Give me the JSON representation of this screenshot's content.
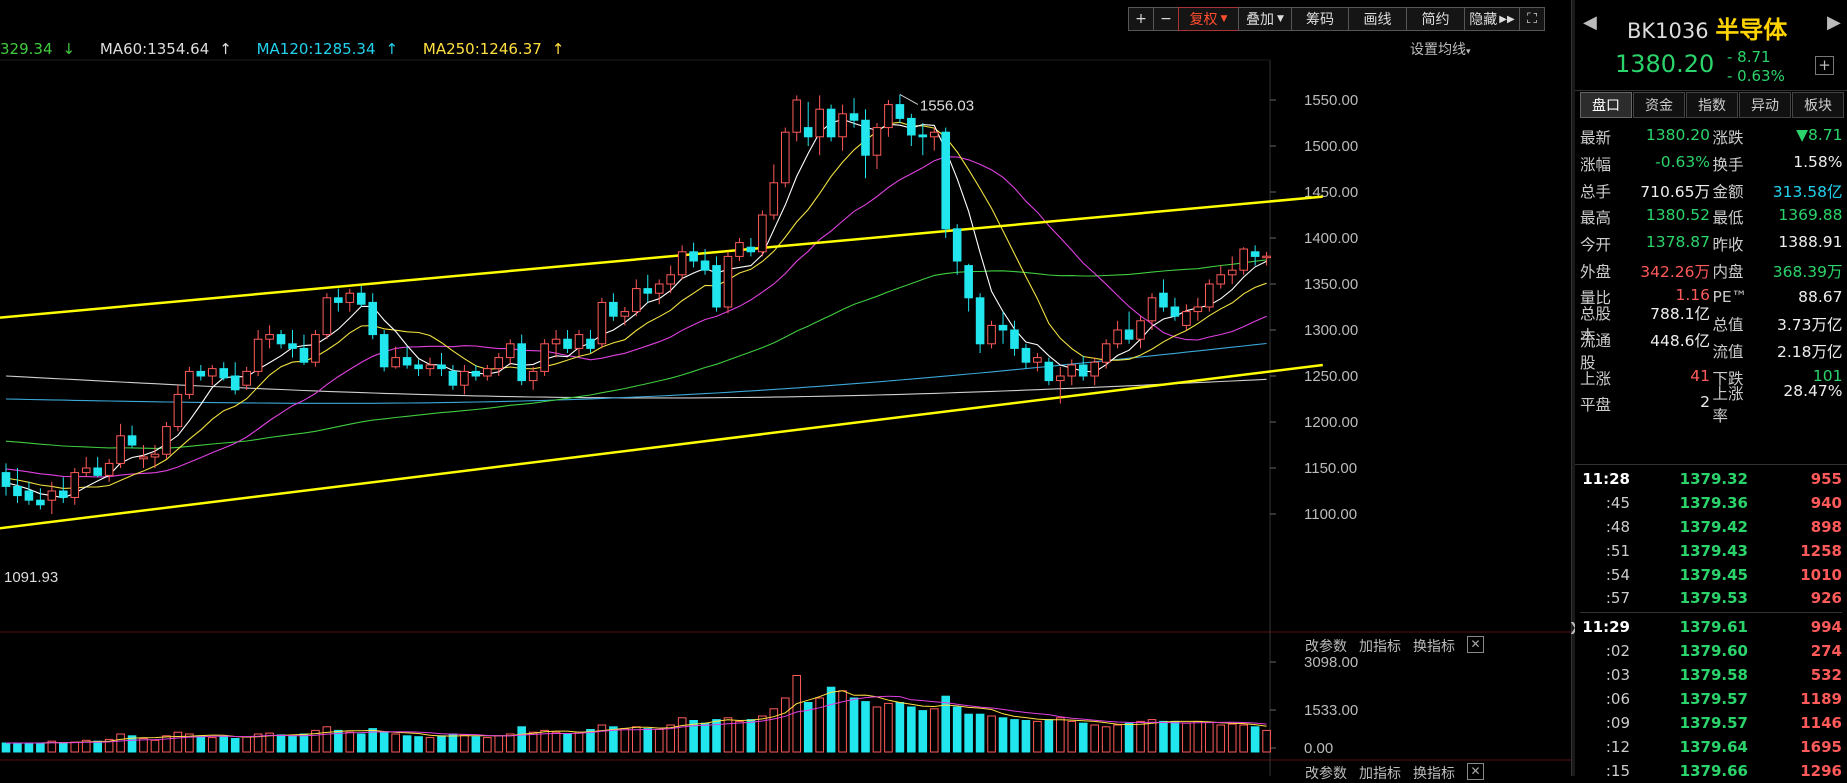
{
  "toolbar": {
    "zoom_in": "+",
    "zoom_out": "−",
    "fuquan": "复权",
    "diejia": "叠加",
    "chouma": "筹码",
    "huaxian": "画线",
    "jianjie": "简约",
    "yincang": "隐藏",
    "fullscreen": "⛶"
  },
  "ma_labels": {
    "ma_partial": "329.34",
    "ma60": "MA60:1354.64",
    "ma120": "MA120:1285.34",
    "ma250": "MA250:1246.37",
    "settings": "设置均线"
  },
  "colors": {
    "up": "#ff5a5a",
    "down": "#22e6ee",
    "ma5": "#ffffff",
    "ma10": "#f0e040",
    "ma20": "#e040e0",
    "ma60": "#3fcc3f",
    "ma120": "#3aa8d8",
    "ma250": "#cfcfcf",
    "trendline": "#ffff00",
    "panel_green": "#2bd46b",
    "panel_red": "#ff5a5a"
  },
  "chart_data": {
    "type": "candlestick",
    "price_axis": {
      "ticks": [
        "1550.00",
        "1500.00",
        "1450.00",
        "1400.00",
        "1350.00",
        "1300.00",
        "1250.00",
        "1200.00",
        "1150.00",
        "1100.00"
      ]
    },
    "volume_axis": {
      "ticks": [
        "3098.00",
        "1533.00",
        "0.00"
      ]
    },
    "annotations": {
      "high": "1556.03",
      "low": "1091.93"
    },
    "ma_values": {
      "ma60": 1354.64,
      "ma120": 1285.34,
      "ma250": 1246.37
    },
    "trendlines": [
      {
        "from": [
          0,
          1313
        ],
        "to": [
          80,
          1445
        ]
      },
      {
        "from": [
          0,
          1084
        ],
        "to": [
          80,
          1262
        ]
      }
    ],
    "ohlc": [
      [
        1145,
        1155,
        1120,
        1130
      ],
      [
        1130,
        1150,
        1112,
        1120
      ],
      [
        1125,
        1135,
        1110,
        1115
      ],
      [
        1115,
        1128,
        1105,
        1110
      ],
      [
        1115,
        1135,
        1100,
        1125
      ],
      [
        1125,
        1140,
        1112,
        1118
      ],
      [
        1118,
        1150,
        1110,
        1145
      ],
      [
        1145,
        1162,
        1140,
        1150
      ],
      [
        1150,
        1162,
        1140,
        1142
      ],
      [
        1142,
        1160,
        1135,
        1155
      ],
      [
        1155,
        1198,
        1150,
        1185
      ],
      [
        1185,
        1196,
        1172,
        1175
      ],
      [
        1160,
        1175,
        1150,
        1162
      ],
      [
        1162,
        1175,
        1150,
        1165
      ],
      [
        1165,
        1200,
        1160,
        1195
      ],
      [
        1195,
        1240,
        1190,
        1230
      ],
      [
        1230,
        1260,
        1225,
        1255
      ],
      [
        1255,
        1262,
        1245,
        1250
      ],
      [
        1250,
        1262,
        1240,
        1258
      ],
      [
        1258,
        1265,
        1245,
        1248
      ],
      [
        1250,
        1265,
        1230,
        1235
      ],
      [
        1240,
        1260,
        1235,
        1255
      ],
      [
        1255,
        1300,
        1250,
        1290
      ],
      [
        1290,
        1305,
        1280,
        1295
      ],
      [
        1295,
        1300,
        1280,
        1285
      ],
      [
        1285,
        1300,
        1270,
        1280
      ],
      [
        1280,
        1295,
        1262,
        1265
      ],
      [
        1265,
        1300,
        1260,
        1295
      ],
      [
        1295,
        1340,
        1290,
        1335
      ],
      [
        1335,
        1345,
        1320,
        1330
      ],
      [
        1330,
        1345,
        1320,
        1340
      ],
      [
        1340,
        1348,
        1325,
        1328
      ],
      [
        1330,
        1340,
        1290,
        1295
      ],
      [
        1295,
        1300,
        1255,
        1260
      ],
      [
        1260,
        1282,
        1258,
        1270
      ],
      [
        1270,
        1282,
        1258,
        1262
      ],
      [
        1262,
        1268,
        1250,
        1258
      ],
      [
        1258,
        1270,
        1250,
        1262
      ],
      [
        1262,
        1275,
        1250,
        1258
      ],
      [
        1255,
        1262,
        1235,
        1240
      ],
      [
        1240,
        1262,
        1230,
        1255
      ],
      [
        1255,
        1262,
        1245,
        1250
      ],
      [
        1250,
        1262,
        1245,
        1258
      ],
      [
        1258,
        1275,
        1250,
        1270
      ],
      [
        1270,
        1290,
        1262,
        1285
      ],
      [
        1285,
        1295,
        1240,
        1245
      ],
      [
        1245,
        1260,
        1235,
        1255
      ],
      [
        1255,
        1290,
        1250,
        1285
      ],
      [
        1285,
        1300,
        1270,
        1290
      ],
      [
        1290,
        1300,
        1275,
        1280
      ],
      [
        1280,
        1300,
        1272,
        1295
      ],
      [
        1290,
        1300,
        1275,
        1280
      ],
      [
        1285,
        1335,
        1280,
        1330
      ],
      [
        1330,
        1340,
        1310,
        1315
      ],
      [
        1315,
        1325,
        1305,
        1320
      ],
      [
        1320,
        1355,
        1315,
        1345
      ],
      [
        1345,
        1360,
        1330,
        1340
      ],
      [
        1340,
        1355,
        1328,
        1350
      ],
      [
        1350,
        1370,
        1340,
        1360
      ],
      [
        1360,
        1392,
        1355,
        1385
      ],
      [
        1385,
        1395,
        1368,
        1375
      ],
      [
        1375,
        1388,
        1360,
        1365
      ],
      [
        1370,
        1380,
        1320,
        1325
      ],
      [
        1325,
        1385,
        1318,
        1380
      ],
      [
        1380,
        1400,
        1375,
        1395
      ],
      [
        1390,
        1400,
        1380,
        1385
      ],
      [
        1385,
        1430,
        1380,
        1425
      ],
      [
        1425,
        1480,
        1420,
        1460
      ],
      [
        1460,
        1520,
        1455,
        1515
      ],
      [
        1515,
        1555,
        1505,
        1550
      ],
      [
        1520,
        1548,
        1500,
        1510
      ],
      [
        1510,
        1555,
        1490,
        1540
      ],
      [
        1540,
        1545,
        1505,
        1510
      ],
      [
        1510,
        1545,
        1495,
        1535
      ],
      [
        1535,
        1552,
        1520,
        1528
      ],
      [
        1528,
        1540,
        1465,
        1490
      ],
      [
        1490,
        1525,
        1475,
        1520
      ],
      [
        1520,
        1550,
        1510,
        1545
      ],
      [
        1545,
        1556.03,
        1525,
        1530
      ],
      [
        1530,
        1535,
        1500,
        1512
      ],
      [
        1512,
        1525,
        1490,
        1510
      ],
      [
        1510,
        1520,
        1495,
        1515
      ],
      [
        1515,
        1520,
        1400,
        1410
      ],
      [
        1410,
        1415,
        1360,
        1375
      ],
      [
        1370,
        1372,
        1320,
        1335
      ],
      [
        1335,
        1340,
        1275,
        1285
      ],
      [
        1285,
        1310,
        1280,
        1305
      ],
      [
        1305,
        1320,
        1285,
        1300
      ],
      [
        1300,
        1310,
        1272,
        1280
      ],
      [
        1280,
        1285,
        1258,
        1265
      ],
      [
        1265,
        1275,
        1255,
        1270
      ],
      [
        1265,
        1270,
        1240,
        1245
      ],
      [
        1245,
        1260,
        1220,
        1250
      ],
      [
        1250,
        1268,
        1240,
        1262
      ],
      [
        1262,
        1272,
        1245,
        1250
      ],
      [
        1250,
        1270,
        1240,
        1265
      ],
      [
        1265,
        1290,
        1258,
        1285
      ],
      [
        1285,
        1310,
        1280,
        1300
      ],
      [
        1300,
        1320,
        1285,
        1290
      ],
      [
        1290,
        1315,
        1280,
        1310
      ],
      [
        1310,
        1340,
        1300,
        1335
      ],
      [
        1340,
        1355,
        1320,
        1325
      ],
      [
        1325,
        1335,
        1310,
        1315
      ],
      [
        1305,
        1328,
        1300,
        1320
      ],
      [
        1320,
        1335,
        1310,
        1325
      ],
      [
        1325,
        1355,
        1320,
        1350
      ],
      [
        1350,
        1370,
        1345,
        1360
      ],
      [
        1360,
        1380,
        1350,
        1365
      ],
      [
        1365,
        1390,
        1360,
        1388
      ],
      [
        1385,
        1392,
        1370,
        1380
      ],
      [
        1380.2,
        1385,
        1370,
        1380.2
      ]
    ],
    "volume_ratio": [
      0.1,
      0.1,
      0.1,
      0.1,
      0.12,
      0.1,
      0.11,
      0.13,
      0.12,
      0.14,
      0.2,
      0.18,
      0.15,
      0.13,
      0.18,
      0.22,
      0.2,
      0.18,
      0.16,
      0.17,
      0.15,
      0.17,
      0.2,
      0.21,
      0.19,
      0.18,
      0.2,
      0.24,
      0.28,
      0.24,
      0.22,
      0.2,
      0.26,
      0.22,
      0.2,
      0.18,
      0.17,
      0.16,
      0.18,
      0.2,
      0.19,
      0.17,
      0.16,
      0.18,
      0.2,
      0.28,
      0.22,
      0.24,
      0.22,
      0.2,
      0.22,
      0.25,
      0.3,
      0.28,
      0.26,
      0.28,
      0.26,
      0.25,
      0.3,
      0.38,
      0.35,
      0.32,
      0.36,
      0.38,
      0.34,
      0.36,
      0.4,
      0.48,
      0.6,
      0.85,
      0.55,
      0.6,
      0.72,
      0.68,
      0.6,
      0.56,
      0.5,
      0.54,
      0.55,
      0.5,
      0.46,
      0.48,
      0.62,
      0.5,
      0.42,
      0.42,
      0.4,
      0.38,
      0.36,
      0.35,
      0.34,
      0.36,
      0.38,
      0.34,
      0.32,
      0.3,
      0.28,
      0.3,
      0.32,
      0.34,
      0.36,
      0.34,
      0.34,
      0.32,
      0.34,
      0.33,
      0.3,
      0.31,
      0.3,
      0.28,
      0.24
    ]
  },
  "sub_tools": {
    "params": "改参数",
    "add_indicator": "加指标",
    "switch_indicator": "换指标",
    "close": "✕"
  },
  "panel": {
    "code": "BK1036",
    "name": "半导体",
    "price": "1380.20",
    "change": "- 8.71",
    "change_pct": "- 0.63%",
    "plus": "+",
    "prev_arrow": "◀",
    "next_arrow": "▶",
    "tabs": [
      "盘口",
      "资金",
      "指数",
      "异动",
      "板块"
    ],
    "quote": [
      {
        "l1": "最新",
        "v1": "1380.20",
        "c1": "down",
        "l2": "涨跌",
        "v2": "▼8.71",
        "c2": "down"
      },
      {
        "l1": "涨幅",
        "v1": "-0.63%",
        "c1": "down",
        "l2": "换手",
        "v2": "1.58%",
        "c2": "white"
      },
      {
        "l1": "总手",
        "v1": "710.65万",
        "c1": "white",
        "l2": "金额",
        "v2": "313.58亿",
        "c2": "cyan"
      },
      {
        "l1": "最高",
        "v1": "1380.52",
        "c1": "down",
        "l2": "最低",
        "v2": "1369.88",
        "c2": "down"
      },
      {
        "l1": "今开",
        "v1": "1378.87",
        "c1": "down",
        "l2": "昨收",
        "v2": "1388.91",
        "c2": "white"
      },
      {
        "l1": "外盘",
        "v1": "342.26万",
        "c1": "up",
        "l2": "内盘",
        "v2": "368.39万",
        "c2": "down"
      },
      {
        "l1": "量比",
        "v1": "1.16",
        "c1": "up",
        "l2": "PE™",
        "v2": "88.67",
        "c2": "white"
      },
      {
        "l1": "总股本",
        "v1": "788.1亿",
        "c1": "white",
        "l2": "总值",
        "v2": "3.73万亿",
        "c2": "white"
      },
      {
        "l1": "流通股",
        "v1": "448.6亿",
        "c1": "white",
        "l2": "流值",
        "v2": "2.18万亿",
        "c2": "white"
      },
      {
        "l1": "上涨",
        "v1": "41",
        "c1": "up",
        "l2": "下跌",
        "v2": "101",
        "c2": "down"
      },
      {
        "l1": "平盘",
        "v1": "2",
        "c1": "white",
        "l2": "上涨率",
        "v2": "28.47%",
        "c2": "white"
      }
    ],
    "ticks": [
      {
        "t": "11:28",
        "p": "1379.32",
        "v": "955",
        "bold": true
      },
      {
        "t": ":45",
        "p": "1379.36",
        "v": "940"
      },
      {
        "t": ":48",
        "p": "1379.42",
        "v": "898"
      },
      {
        "t": ":51",
        "p": "1379.43",
        "v": "1258"
      },
      {
        "t": ":54",
        "p": "1379.45",
        "v": "1010"
      },
      {
        "t": ":57",
        "p": "1379.53",
        "v": "926"
      },
      {
        "t": "11:29",
        "p": "1379.61",
        "v": "994",
        "bold": true
      },
      {
        "t": ":02",
        "p": "1379.60",
        "v": "274"
      },
      {
        "t": ":03",
        "p": "1379.58",
        "v": "532"
      },
      {
        "t": ":06",
        "p": "1379.57",
        "v": "1189"
      },
      {
        "t": ":09",
        "p": "1379.57",
        "v": "1146"
      },
      {
        "t": ":12",
        "p": "1379.64",
        "v": "1695"
      },
      {
        "t": ":15",
        "p": "1379.66",
        "v": "1296"
      }
    ]
  }
}
